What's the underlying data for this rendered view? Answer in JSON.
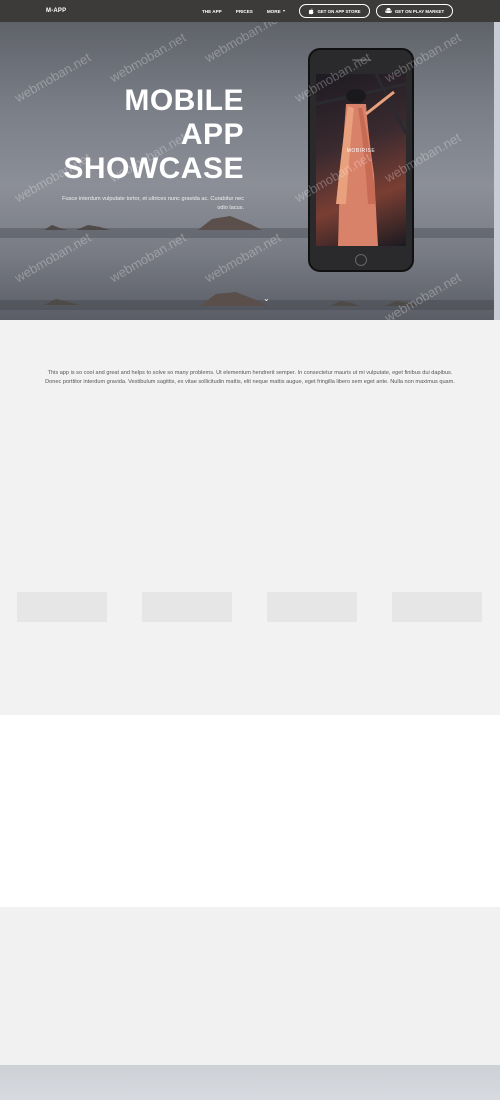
{
  "nav": {
    "logo": "M-APP",
    "links": [
      "THE APP",
      "PRICES",
      "MORE"
    ],
    "app_store_label": "GET ON APP STORE",
    "play_market_label": "GET ON PLAY MARKET"
  },
  "hero": {
    "title_line1": "MOBILE",
    "title_line2": "APP",
    "title_line3": "SHOWCASE",
    "subtitle": "Fusce interdum vulputate tortor, et ultrices nunc gravida ac. Curabitur nec odio lacus.",
    "phone_screen_label": "MOBIRISE"
  },
  "intro": {
    "text": "This app is so cool and great and helps to solve so many problems. Ut elementum hendrerit semper. In consectetur mauris ut mi vulputate, eget finibus dui dapibus. Donec porttitor interdum gravida. Vestibulum sagittis, ex vitae sollicitudin mattis, elit neque mattis augue, eget fringilla libero sem eget ante. Nulla non maximus quam."
  },
  "watermark": "webmoban.net",
  "colors": {
    "navbar": "#3d3b3a",
    "hero": "#7b7f88",
    "page": "#f2f2f2"
  }
}
